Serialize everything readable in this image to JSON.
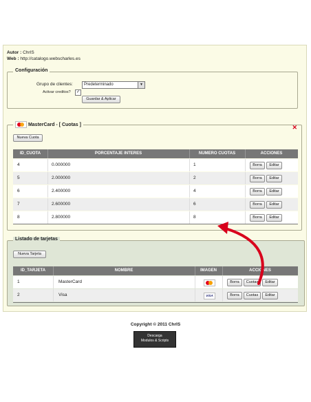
{
  "author": {
    "label": "Autor :",
    "value": "ChrIS",
    "web_label": "Web :",
    "web_value": "http://catalogo.webscharles.es"
  },
  "config": {
    "legend": "Configuración",
    "group_label": "Grupo de clientes:",
    "group_value": "Predeterminado",
    "credits_label": "Activar creditos?",
    "save_button": "Guardar & Aplicar"
  },
  "quotas": {
    "legend": "MasterCard - [ Cuotas ]",
    "close": "✕",
    "new_button": "Nueva Cuota",
    "headers": [
      "ID_CUOTA",
      "PORCENTAJE INTERES",
      "NUMERO CUOTAS",
      "ACCIONES"
    ],
    "rows": [
      {
        "id": "4",
        "pct": "0.000000",
        "num": "1"
      },
      {
        "id": "5",
        "pct": "2.000000",
        "num": "2"
      },
      {
        "id": "6",
        "pct": "2.400000",
        "num": "4"
      },
      {
        "id": "7",
        "pct": "2.600000",
        "num": "6"
      },
      {
        "id": "8",
        "pct": "2.800000",
        "num": "8"
      }
    ],
    "delete_label": "Borra",
    "edit_label": "Editar"
  },
  "cards": {
    "legend": "Listado de tarjetas",
    "new_button": "Nueva Tarjeta",
    "headers": [
      "ID_TARJETA",
      "NOMBRE",
      "IMAGEN",
      "ACCIONES"
    ],
    "rows": [
      {
        "id": "1",
        "name": "MasterCard",
        "logo": "mastercard-logo"
      },
      {
        "id": "2",
        "name": "Visa",
        "logo": "visa-logo"
      }
    ],
    "delete_label": "Borra",
    "quotas_label": "Cuotas",
    "edit_label": "Editar",
    "visa_text": "VISA"
  },
  "footer": {
    "copyright": "Copyright © 2011 ChrIS",
    "badge_line1": "Descarga",
    "badge_line2": "Modulos & Scripts"
  },
  "colors": {
    "panel_bg": "#fbfbe6",
    "cards_bg": "#dfe6d6",
    "header_bg": "#777777",
    "arrow": "#d8001c"
  }
}
